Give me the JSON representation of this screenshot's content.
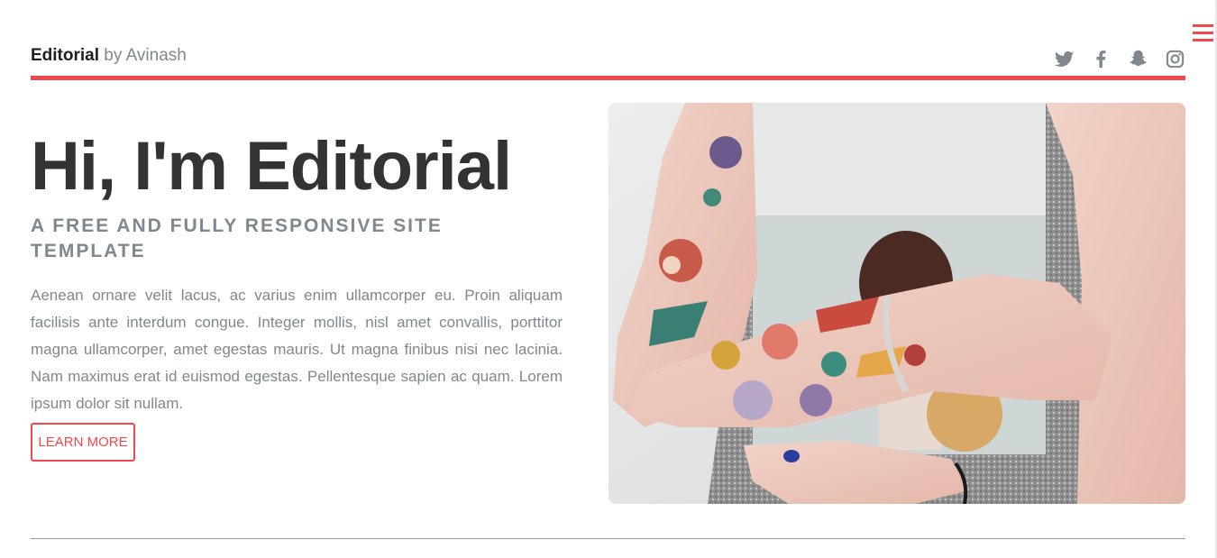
{
  "header": {
    "logo_strong": "Editorial",
    "logo_rest": " by Avinash"
  },
  "social": {
    "icons": [
      "twitter-icon",
      "facebook-icon",
      "snapchat-icon",
      "instagram-icon"
    ]
  },
  "banner": {
    "title": "Hi, I'm Editorial",
    "subtitle": "A free and fully responsive site template",
    "text": "Aenean ornare velit lacus, ac varius enim ullamcorper eu. Proin aliquam facilisis ante interdum congue. Integer mollis, nisl amet convallis, porttitor magna ullamcorper, amet egestas mauris. Ut magna finibus nisi nec lacinia. Nam maximus erat id euismod egestas. Pellentesque sapien ac quam. Lorem ipsum dolor sit nullam.",
    "button_label": "Learn More"
  },
  "colors": {
    "accent": "#f2484d",
    "heading": "#333333",
    "body_text": "#7f888f",
    "icon": "#7f888f"
  }
}
